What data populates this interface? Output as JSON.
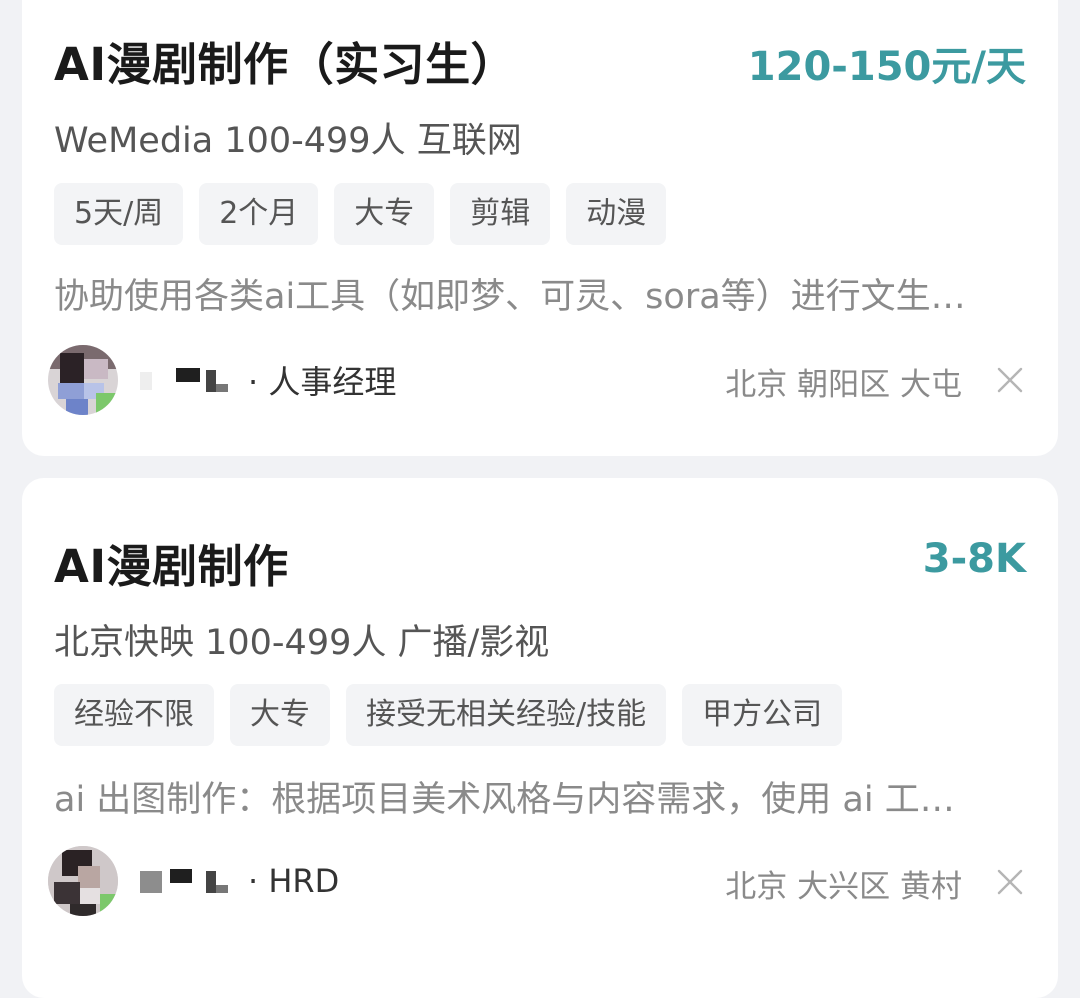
{
  "jobs": [
    {
      "title": "AI漫剧制作（实习生）",
      "salary": "120-150元/天",
      "company_line": "WeMedia 100-499人 互联网",
      "tags": [
        "5天/周",
        "2个月",
        "大专",
        "剪辑",
        "动漫"
      ],
      "description": "协助使用各类ai工具（如即梦、可灵、sora等）进行文生…",
      "recruiter_role": "· 人事经理",
      "location": "北京 朝阳区 大屯",
      "dismiss_icon": "close-icon"
    },
    {
      "title": "AI漫剧制作",
      "salary": "3-8K",
      "company_line": "北京快映 100-499人 广播/影视",
      "tags": [
        "经验不限",
        "大专",
        "接受无相关经验/技能",
        "甲方公司"
      ],
      "description": "ai 出图制作：根据项目美术风格与内容需求，使用 ai 工…",
      "recruiter_role": "· HRD",
      "location": "北京 大兴区 黄村",
      "dismiss_icon": "close-icon"
    }
  ],
  "colors": {
    "salary": "#3c9aa0",
    "title": "#1a1a1a",
    "tag_bg": "#f3f4f6",
    "page_bg": "#f1f2f5"
  }
}
